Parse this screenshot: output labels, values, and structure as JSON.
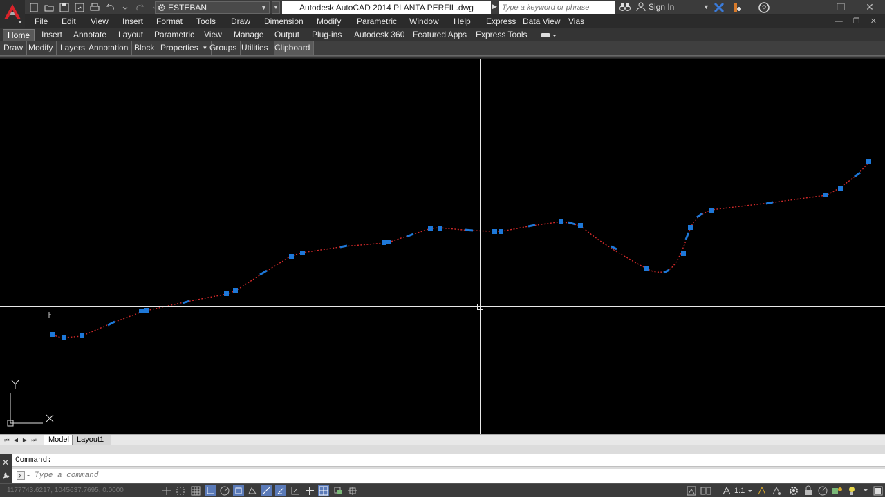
{
  "title": "Autodesk AutoCAD 2014    PLANTA PERFIL.dwg",
  "workspace": "ESTEBAN",
  "search": {
    "placeholder": "Type a keyword or phrase"
  },
  "user": {
    "sign_in": "Sign In"
  },
  "menu": [
    "File",
    "Edit",
    "View",
    "Insert",
    "Format",
    "Tools",
    "Draw",
    "Dimension",
    "Modify",
    "Parametric",
    "Window",
    "Help",
    "Express",
    "Data View",
    "Vias"
  ],
  "ribbon_tabs": [
    "Home",
    "Insert",
    "Annotate",
    "Layout",
    "Parametric",
    "View",
    "Manage",
    "Output",
    "Plug-ins",
    "Autodesk 360",
    "Featured Apps",
    "Express Tools"
  ],
  "active_ribbon_tab": "Home",
  "panels": [
    "Draw",
    "Modify",
    "Layers",
    "Annotation",
    "Block",
    "Properties",
    "Groups",
    "Utilities",
    "Clipboard"
  ],
  "properties_suffix": "▾",
  "ucs": {
    "y_label": "Y",
    "x_label": "X"
  },
  "layout_tabs": {
    "model": "Model",
    "layout1": "Layout1"
  },
  "command": {
    "history": "Command:",
    "placeholder": "Type a command"
  },
  "status": {
    "coords": "1177743.6217, 1045637.7695, 0.0000",
    "scale": "1:1"
  },
  "colors": {
    "background": "#000000",
    "polyline": "#d42a2a",
    "grips": "#1e78d8",
    "crosshair": "#e8e8e8"
  }
}
